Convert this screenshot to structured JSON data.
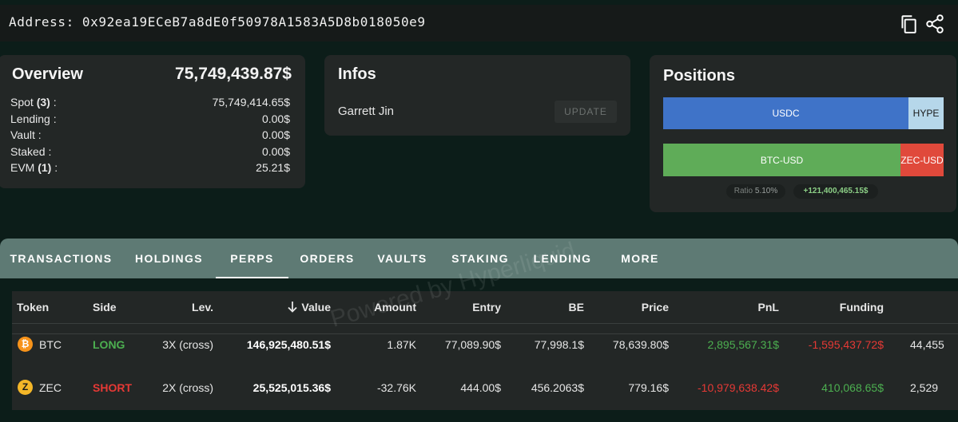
{
  "address": {
    "label": "Address:",
    "value": "0x92ea19ECeB7a8dE0f50978A1583A5D8b018050e9"
  },
  "icons": {
    "copy": "copy-icon",
    "share": "share-icon"
  },
  "overview": {
    "title": "Overview",
    "total": "75,749,439.87$",
    "rows": [
      {
        "label": "Spot",
        "count": "(3)",
        "suffix": " :",
        "value": "75,749,414.65$"
      },
      {
        "label": "Lending :",
        "count": "",
        "suffix": "",
        "value": "0.00$"
      },
      {
        "label": "Vault :",
        "count": "",
        "suffix": "",
        "value": "0.00$"
      },
      {
        "label": "Staked :",
        "count": "",
        "suffix": "",
        "value": "0.00$"
      },
      {
        "label": "EVM",
        "count": "(1)",
        "suffix": " :",
        "value": "25.21$"
      }
    ]
  },
  "infos": {
    "title": "Infos",
    "name": "Garrett Jin",
    "update_label": "UPDATE"
  },
  "positions": {
    "title": "Positions",
    "spot_bar": [
      {
        "label": "USDC",
        "share": 0.875,
        "color": "#3f73c8"
      },
      {
        "label": "HYPE",
        "share": 0.125,
        "color": "#b6d7ea"
      }
    ],
    "perp_bar": [
      {
        "label": "BTC-USD",
        "share": 0.845,
        "color": "#5fac58"
      },
      {
        "label": "ZEC-USD",
        "share": 0.155,
        "color": "#e0493b"
      }
    ],
    "ratio_label": "Ratio",
    "ratio_value": "5.10%",
    "pnl": "+121,400,465.15$"
  },
  "tabs": [
    {
      "label": "TRANSACTIONS",
      "active": false
    },
    {
      "label": "HOLDINGS",
      "active": false
    },
    {
      "label": "PERPS",
      "active": true
    },
    {
      "label": "ORDERS",
      "active": false
    },
    {
      "label": "VAULTS",
      "active": false
    },
    {
      "label": "STAKING",
      "active": false
    },
    {
      "label": "LENDING",
      "active": false
    },
    {
      "label": "MORE",
      "active": false
    }
  ],
  "table": {
    "headers": {
      "token": "Token",
      "side": "Side",
      "lev": "Lev.",
      "sort_icon": "arrow-down-icon",
      "value": "Value",
      "amount": "Amount",
      "entry": "Entry",
      "be": "BE",
      "price": "Price",
      "pnl": "PnL",
      "funding": "Funding"
    },
    "rows": [
      {
        "coin_icon": "bitcoin-icon",
        "coin_glyph": "₿",
        "coin_color": "#f7931a",
        "token": "BTC",
        "side": "LONG",
        "side_color": "#4caf50",
        "lev": "3X (cross)",
        "value": "146,925,480.51$",
        "amount": "1.87K",
        "entry": "77,089.90$",
        "be": "77,998.1$",
        "price": "78,639.80$",
        "pnl": "2,895,567.31$",
        "pnl_color": "#4caf50",
        "funding": "-1,595,437.72$",
        "funding_color": "#e53935",
        "extra": "44,455"
      },
      {
        "coin_icon": "zcash-icon",
        "coin_glyph": "Z",
        "coin_color": "#f4b728",
        "token": "ZEC",
        "side": "SHORT",
        "side_color": "#e53935",
        "lev": "2X (cross)",
        "value": "25,525,015.36$",
        "amount": "-32.76K",
        "entry": "444.00$",
        "be": "456.2063$",
        "price": "779.16$",
        "pnl": "-10,979,638.42$",
        "pnl_color": "#e53935",
        "funding": "410,068.65$",
        "funding_color": "#4caf50",
        "extra": "2,529"
      }
    ]
  },
  "watermark": "Powered by Hyperliquid"
}
